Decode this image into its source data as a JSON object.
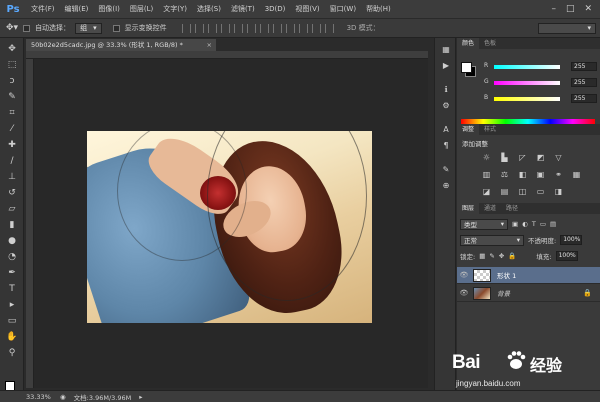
{
  "app": {
    "logo": "Ps",
    "menu": [
      "文件(F)",
      "编辑(E)",
      "图像(I)",
      "图层(L)",
      "文字(Y)",
      "选择(S)",
      "滤镜(T)",
      "3D(D)",
      "视图(V)",
      "窗口(W)",
      "帮助(H)"
    ],
    "window_controls": [
      "–",
      "□",
      "✕"
    ]
  },
  "options_bar": {
    "auto_select_label": "自动选择：",
    "auto_select_value": "组",
    "show_transform_label": "显示变换控件",
    "mode_3d_label": "3D 模式："
  },
  "document": {
    "tab_title": "50b02e2d5cadc.jpg @ 33.3% (形状 1, RGB/8) *",
    "close_glyph": "×"
  },
  "color_panel": {
    "tabs": [
      "颜色",
      "色板"
    ],
    "r_label": "R",
    "g_label": "G",
    "b_label": "B",
    "r_value": "255",
    "g_value": "255",
    "b_value": "255"
  },
  "adjustments_panel": {
    "tabs": [
      "调整",
      "样式"
    ],
    "title": "添加调整"
  },
  "layers_panel": {
    "tabs": [
      "图层",
      "通道",
      "路径"
    ],
    "filter_kind": "类型",
    "blend_mode": "正常",
    "opacity_label": "不透明度:",
    "opacity_value": "100%",
    "lock_label": "锁定:",
    "fill_label": "填充:",
    "fill_value": "100%",
    "layers": [
      {
        "name": "形状 1",
        "selected": true
      },
      {
        "name": "背景",
        "selected": false
      }
    ]
  },
  "status_bar": {
    "zoom": "33.33%",
    "doc_info": "文档:3.96M/3.96M"
  },
  "watermark": {
    "brand": "Bai",
    "brand2": "经验",
    "url": "jingyan.baidu.com"
  },
  "colors": {
    "accent_selected_layer": "#5a6e8c",
    "background": "#2b2b2b"
  }
}
